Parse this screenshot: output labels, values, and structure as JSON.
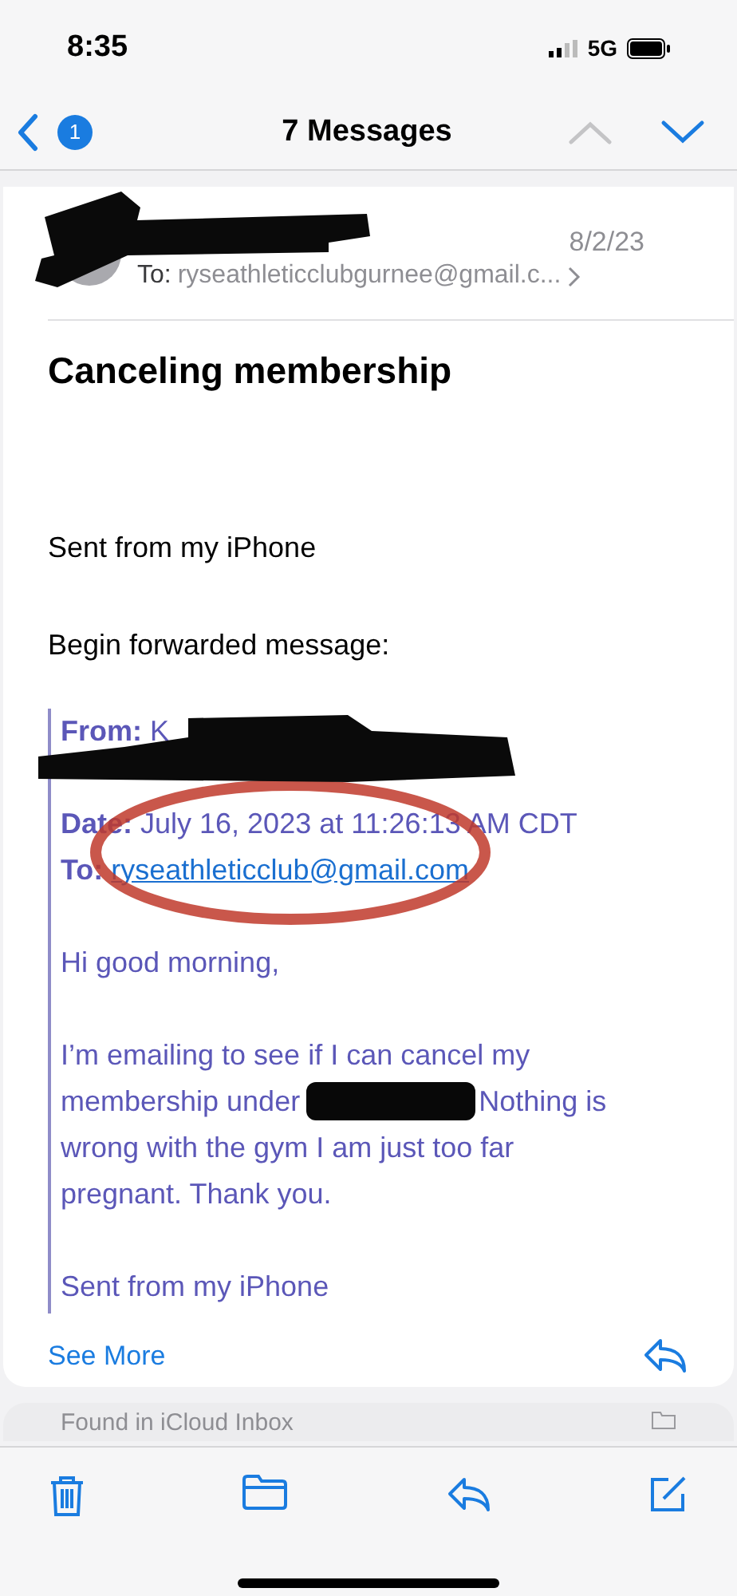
{
  "status_bar": {
    "time": "8:35",
    "network": "5G"
  },
  "nav": {
    "badge": "1",
    "title": "7 Messages",
    "prev_enabled": false,
    "next_enabled": true
  },
  "message": {
    "date": "8/2/23",
    "to_label": "To:",
    "to": "ryseathleticclubgurnee@gmail.c...",
    "subject": "Canceling membership",
    "lines": [
      "Sent from my iPhone",
      "Begin forwarded message:"
    ],
    "forwarded": {
      "from_label": "From:",
      "from": "K",
      "date_label": "Date:",
      "date": "July 16, 2023 at 11:26:13 AM CDT",
      "to_label": "To:",
      "to": "ryseathleticclub@gmail.com",
      "greeting": "Hi good morning,",
      "body_lines": [
        "I’m emailing to see if I can cancel my",
        "membership under",
        "Nothing is",
        "wrong with the gym I am just too far",
        "pregnant. Thank you."
      ],
      "signature": "Sent from my iPhone"
    },
    "see_more": "See More"
  },
  "next_card": {
    "label": "Found in iCloud Inbox"
  }
}
